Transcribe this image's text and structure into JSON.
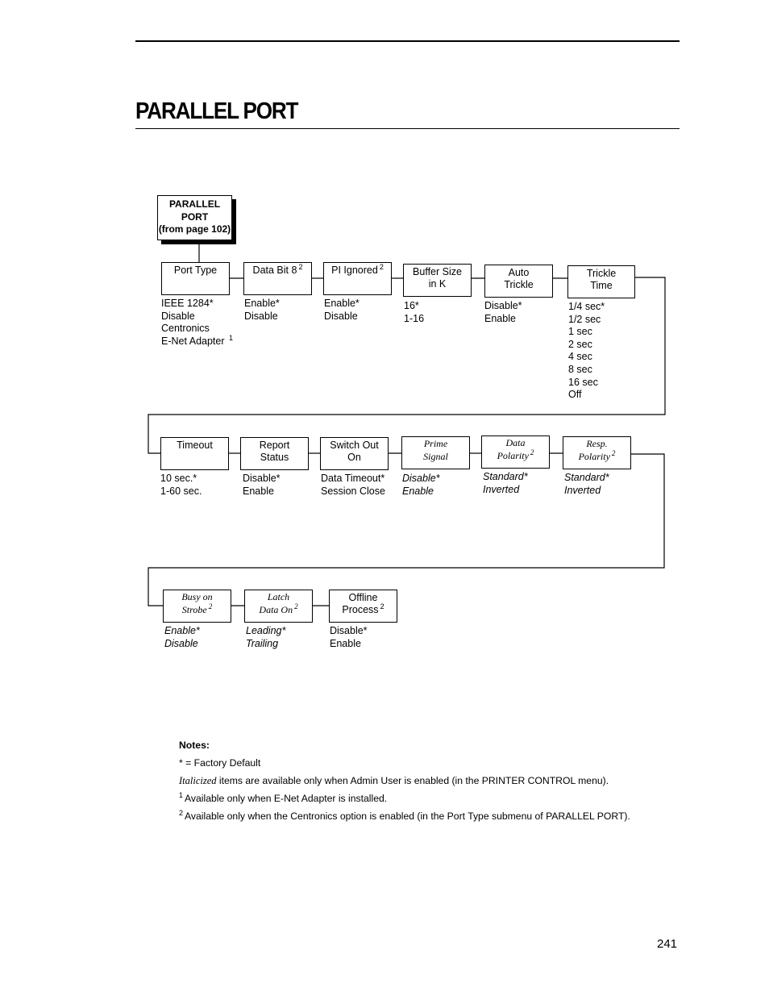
{
  "header": {
    "title": "PARALLEL PORT"
  },
  "diagram": {
    "root": {
      "lines": [
        "PARALLEL",
        "PORT",
        "(from page 102)"
      ]
    },
    "menus": [
      {
        "id": "port-type",
        "label": [
          "Port Type"
        ],
        "footnote": "",
        "admin_only": false,
        "options": [
          {
            "text": "IEEE 1284*"
          },
          {
            "text": "Disable"
          },
          {
            "text": "Centronics"
          },
          {
            "text": "E-Net Adapter",
            "sup": "1"
          }
        ]
      },
      {
        "id": "data-bit-8",
        "label": [
          "Data Bit 8"
        ],
        "footnote": "2",
        "admin_only": false,
        "options": [
          {
            "text": "Enable*"
          },
          {
            "text": "Disable"
          }
        ]
      },
      {
        "id": "pi-ignored",
        "label": [
          "PI Ignored"
        ],
        "footnote": "2",
        "admin_only": false,
        "options": [
          {
            "text": "Enable*"
          },
          {
            "text": "Disable"
          }
        ]
      },
      {
        "id": "buffer-size",
        "label": [
          "Buffer Size",
          "in K"
        ],
        "footnote": "",
        "admin_only": false,
        "options": [
          {
            "text": "16*"
          },
          {
            "text": "1-16"
          }
        ]
      },
      {
        "id": "auto-trickle",
        "label": [
          "Auto",
          "Trickle"
        ],
        "footnote": "",
        "admin_only": false,
        "options": [
          {
            "text": "Disable*"
          },
          {
            "text": "Enable"
          }
        ]
      },
      {
        "id": "trickle-time",
        "label": [
          "Trickle",
          "Time"
        ],
        "footnote": "",
        "admin_only": false,
        "options": [
          {
            "text": "1/4 sec*"
          },
          {
            "text": "1/2 sec"
          },
          {
            "text": "1 sec"
          },
          {
            "text": "2 sec"
          },
          {
            "text": "4 sec"
          },
          {
            "text": "8 sec"
          },
          {
            "text": "16 sec"
          },
          {
            "text": "Off"
          }
        ]
      },
      {
        "id": "timeout",
        "label": [
          "Timeout"
        ],
        "footnote": "",
        "admin_only": false,
        "options": [
          {
            "text": "10 sec.*"
          },
          {
            "text": "1-60 sec."
          }
        ]
      },
      {
        "id": "report-status",
        "label": [
          "Report",
          "Status"
        ],
        "footnote": "",
        "admin_only": false,
        "options": [
          {
            "text": "Disable*"
          },
          {
            "text": "Enable"
          }
        ]
      },
      {
        "id": "switch-out-on",
        "label": [
          "Switch Out",
          "On"
        ],
        "footnote": "",
        "admin_only": false,
        "options": [
          {
            "text": "Data Timeout*"
          },
          {
            "text": "Session Close"
          }
        ]
      },
      {
        "id": "prime-signal",
        "label": [
          "Prime",
          "Signal"
        ],
        "footnote": "",
        "admin_only": true,
        "options": [
          {
            "text": "Disable*"
          },
          {
            "text": "Enable"
          }
        ]
      },
      {
        "id": "data-polarity",
        "label": [
          "Data",
          "Polarity"
        ],
        "footnote": "2",
        "admin_only": true,
        "options": [
          {
            "text": "Standard*"
          },
          {
            "text": "Inverted"
          }
        ]
      },
      {
        "id": "resp-polarity",
        "label": [
          "Resp.",
          "Polarity"
        ],
        "footnote": "2",
        "admin_only": true,
        "options": [
          {
            "text": "Standard*"
          },
          {
            "text": "Inverted"
          }
        ]
      },
      {
        "id": "busy-on-strobe",
        "label": [
          "Busy on",
          "Strobe"
        ],
        "footnote": "2",
        "admin_only": true,
        "options": [
          {
            "text": "Enable*"
          },
          {
            "text": "Disable"
          }
        ]
      },
      {
        "id": "latch-data-on",
        "label": [
          "Latch",
          "Data On"
        ],
        "footnote": "2",
        "admin_only": true,
        "options": [
          {
            "text": "Leading*"
          },
          {
            "text": "Trailing"
          }
        ]
      },
      {
        "id": "offline-process",
        "label": [
          "Offline",
          "Process"
        ],
        "footnote": "2",
        "admin_only": false,
        "options": [
          {
            "text": "Disable*"
          },
          {
            "text": "Enable"
          }
        ]
      }
    ]
  },
  "notes": {
    "heading": "Notes:",
    "factory_default": "* = Factory Default",
    "italic_word": "Italicized",
    "italic_rest": " items are available only when Admin User is enabled (in the PRINTER CONTROL menu).",
    "footnote_1_mark": "1",
    "footnote_1": "Available only when E-Net Adapter is installed.",
    "footnote_2_mark": "2",
    "footnote_2": "Available only when the Centronics option is enabled (in the Port Type submenu of PARALLEL PORT)."
  },
  "footer": {
    "page_number": "241"
  }
}
